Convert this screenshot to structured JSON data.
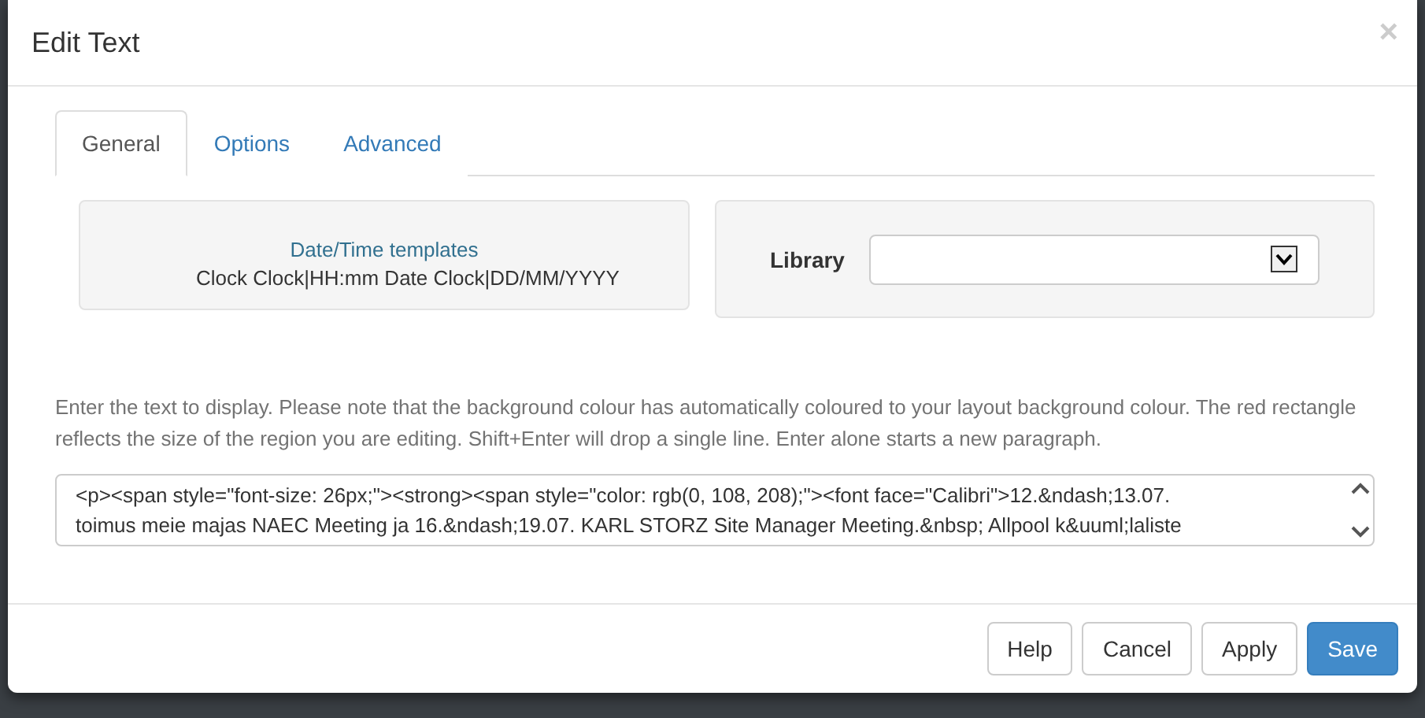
{
  "dialog": {
    "title": "Edit Text",
    "close": "×"
  },
  "tabs": [
    {
      "label": "General",
      "selected": true
    },
    {
      "label": "Options",
      "selected": false
    },
    {
      "label": "Advanced",
      "selected": false
    }
  ],
  "templates": {
    "title": "Date/Time templates",
    "items": "Clock Clock|HH:mm Date Clock|DD/MM/YYYY"
  },
  "library": {
    "label": "Library"
  },
  "help_text": "Enter the text to display. Please note that the background colour has automatically coloured to your layout background colour. The red rectangle reflects the size of the region you are editing. Shift+Enter will drop a single line. Enter alone starts a new paragraph.",
  "editor": {
    "value_lines": [
      "<p><span style=\"font-size: 26px;\"><strong><span style=\"color: rgb(0, 108, 208);\"><font face=\"Calibri\">12.&ndash;13.07.",
      "toimus meie majas NAEC Meeting ja 16.&ndash;19.07. KARL STORZ Site Manager Meeting.&nbsp; Allpool k&uuml;laliste"
    ]
  },
  "buttons": [
    {
      "label": "Help",
      "kind": "default"
    },
    {
      "label": "Cancel",
      "kind": "default"
    },
    {
      "label": "Apply",
      "kind": "default"
    },
    {
      "label": "Save",
      "kind": "primary"
    }
  ]
}
